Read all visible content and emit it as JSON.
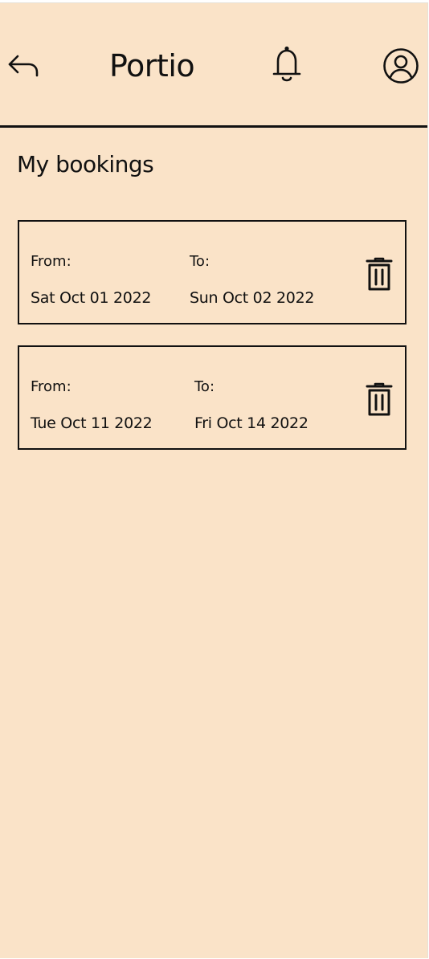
{
  "header": {
    "title": "Portio",
    "back_icon": "back-arrow-icon",
    "notifications_icon": "bell-icon",
    "profile_icon": "user-circle-icon"
  },
  "page": {
    "heading": "My bookings"
  },
  "bookings": [
    {
      "from_label": "From:",
      "from_date": "Sat Oct 01 2022",
      "to_label": "To:",
      "to_date": "Sun Oct 02 2022",
      "delete_icon": "trash-icon"
    },
    {
      "from_label": "From:",
      "from_date": "Tue Oct 11 2022",
      "to_label": "To:",
      "to_date": "Fri Oct 14 2022",
      "delete_icon": "trash-icon"
    }
  ],
  "colors": {
    "background": "#fae3c8",
    "foreground": "#111111"
  }
}
